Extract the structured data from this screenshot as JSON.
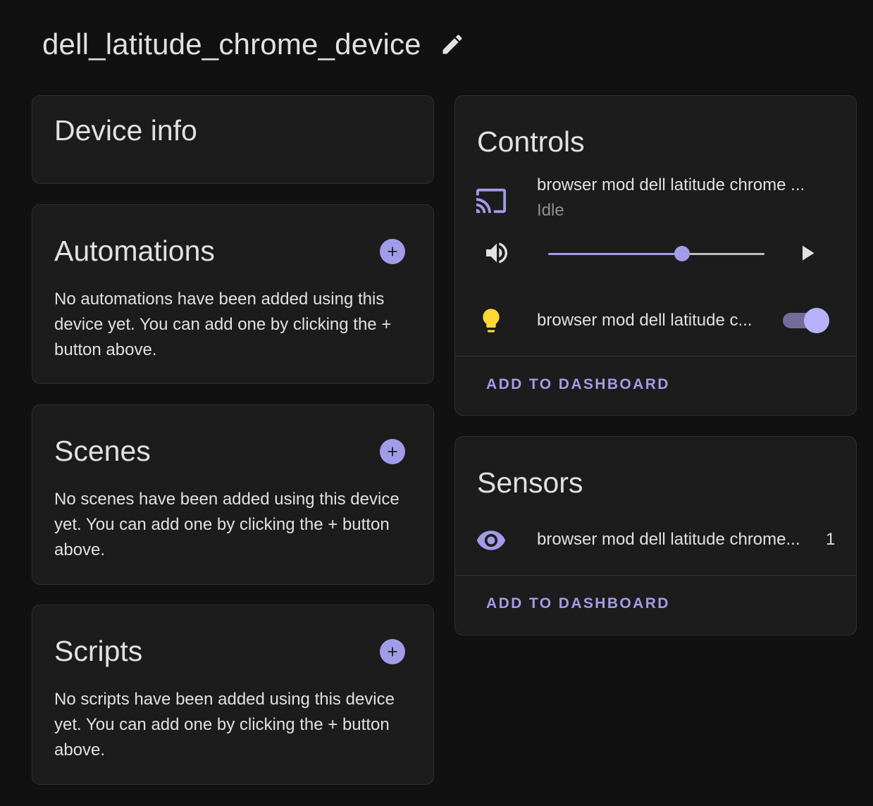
{
  "device": {
    "title": "dell_latitude_chrome_device"
  },
  "device_info": {
    "title": "Device info"
  },
  "automations": {
    "title": "Automations",
    "empty_text": "No automations have been added using this device yet. You can add one by clicking the + button above."
  },
  "scenes": {
    "title": "Scenes",
    "empty_text": "No scenes have been added using this device yet. You can add one by clicking the + button above."
  },
  "scripts": {
    "title": "Scripts",
    "empty_text": "No scripts have been added using this device yet. You can add one by clicking the + button above."
  },
  "controls": {
    "title": "Controls",
    "media_player": {
      "name": "browser mod dell latitude chrome ...",
      "state": "Idle",
      "icon": "cast-icon",
      "volume_icon": "volume-icon",
      "volume_level": 0.62,
      "play_icon": "play-icon"
    },
    "light": {
      "name": "browser mod dell latitude c...",
      "icon": "lightbulb-icon",
      "state_on": true
    },
    "add_to_dashboard": "ADD TO DASHBOARD"
  },
  "sensors": {
    "title": "Sensors",
    "items": [
      {
        "name": "browser mod dell latitude chrome...",
        "value": "1",
        "icon": "eye-icon"
      }
    ],
    "add_to_dashboard": "ADD TO DASHBOARD"
  },
  "colors": {
    "background": "#111111",
    "card": "#1c1c1c",
    "accent": "#a29ce8",
    "text": "#e1e1e1",
    "secondary_text": "#8f8f8f",
    "bulb": "#fdd835"
  }
}
